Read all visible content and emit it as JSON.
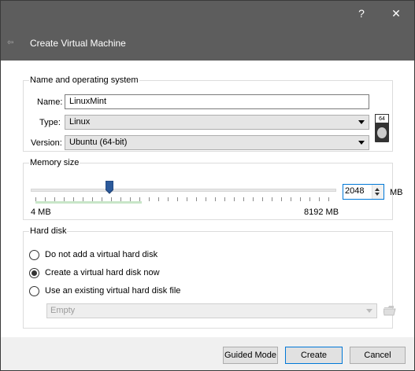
{
  "titlebar": {
    "help_label": "?",
    "close_label": "✕"
  },
  "header": {
    "title": "Create Virtual Machine",
    "back_icon": "back-arrow-icon"
  },
  "os_group": {
    "title": "Name and operating system",
    "name_label": "Name:",
    "name_value": "LinuxMint",
    "type_label": "Type:",
    "type_value": "Linux",
    "version_label": "Version:",
    "version_value": "Ubuntu (64-bit)",
    "os_icon_badge": "64"
  },
  "memory_group": {
    "title": "Memory size",
    "min_label": "4 MB",
    "max_label": "8192 MB",
    "value": "2048",
    "unit": "MB",
    "slider_fraction": 0.25
  },
  "disk_group": {
    "title": "Hard disk",
    "options": [
      {
        "label": "Do not add a virtual hard disk",
        "checked": false
      },
      {
        "label": "Create a virtual hard disk now",
        "checked": true
      },
      {
        "label": "Use an existing virtual hard disk file",
        "checked": false
      }
    ],
    "existing_file_value": "Empty"
  },
  "footer": {
    "guided_label": "Guided Mode",
    "create_label": "Create",
    "cancel_label": "Cancel"
  },
  "colors": {
    "header_bg": "#5d5d5d",
    "accent": "#0078d7",
    "thumb": "#2c5a9b"
  }
}
